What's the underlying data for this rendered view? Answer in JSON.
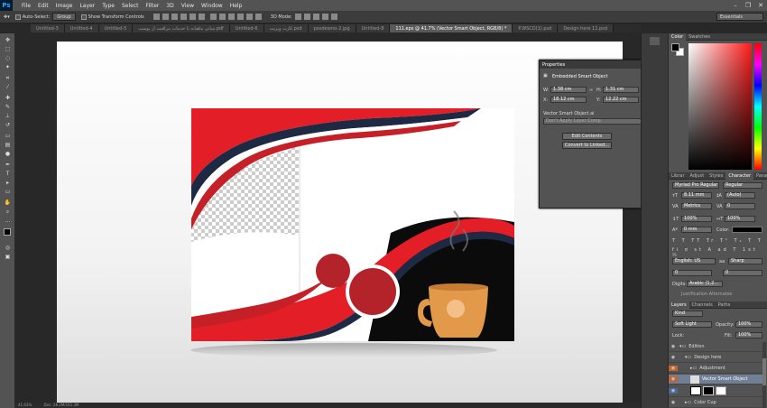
{
  "app": {
    "logo": "Ps"
  },
  "menu": [
    "File",
    "Edit",
    "Image",
    "Layer",
    "Type",
    "Select",
    "Filter",
    "3D",
    "View",
    "Window",
    "Help"
  ],
  "window_controls": [
    "–",
    "❐",
    "✕"
  ],
  "options": {
    "auto_select_label": "Auto-Select:",
    "auto_select_value": "Group",
    "transform_label": "Show Transform Controls",
    "mode_label": "3D Mode:",
    "workspace": "Essentials"
  },
  "tabs": [
    {
      "label": "Untitled-3"
    },
    {
      "label": "Untitled-4"
    },
    {
      "label": "Untitled-5"
    },
    {
      "label": "سانی ماهیانه با خدمات مراقبت از پوست.pdf"
    },
    {
      "label": "Untitled-6"
    },
    {
      "label": "کارت ویزیت.psd"
    },
    {
      "label": "posdesmo-2.jpg"
    },
    {
      "label": "Untitled-8"
    },
    {
      "label": "111.eps @ 41.7% (Vector Smart Object, RGB/8) *",
      "active": true
    },
    {
      "label": "P.WSCD(1).psd"
    },
    {
      "label": "Design here 11.psd"
    }
  ],
  "properties": {
    "tab_label": "Properties",
    "type_label": "Embedded Smart Object",
    "w_label": "W:",
    "w_value": "1.38 cm",
    "h_label": "H:",
    "h_value": "1.31 cm",
    "x_label": "X:",
    "x_value": "18.12 cm",
    "y_label": "Y:",
    "y_value": "12.22 cm",
    "source_label": "Vector Smart Object.ai",
    "layer_comp": "Don't Apply Layer Comp",
    "edit_button": "Edit Contents",
    "convert_button": "Convert to Linked..."
  },
  "color_panel": {
    "tabs": [
      "Color",
      "Swatches"
    ]
  },
  "char_panel": {
    "tabs": [
      "Librar",
      "Adjust",
      "Styles",
      "Character",
      "Parag"
    ],
    "font_family": "Myriad Pro Regular",
    "font_style": "Regular",
    "font_size": "8.11 mm",
    "leading": "(Auto)",
    "kerning": "Metrics",
    "tracking": "0",
    "v_scale": "100%",
    "h_scale": "100%",
    "baseline": "0 mm",
    "color_label": "Color:",
    "language": "English: US",
    "antialias": "Sharp",
    "aa_label": "aa",
    "digits_label": "Digits:",
    "digits_value": "Arabic (1,2...",
    "justification": "Justification Alternates"
  },
  "layers_panel": {
    "tabs": [
      "Layers",
      "Channels",
      "Paths"
    ],
    "filter": "Kind",
    "blend": "Soft Light",
    "opacity_label": "Opacity:",
    "opacity": "100%",
    "fill_label": "Fill:",
    "fill": "100%",
    "lock_label": "Lock:",
    "layers": [
      {
        "name": "Edition",
        "type": "group",
        "indent": 0
      },
      {
        "name": "Design here",
        "type": "group",
        "indent": 1
      },
      {
        "name": "Adjustment",
        "type": "group",
        "indent": 2
      },
      {
        "name": "Vector Smart Object",
        "type": "smart",
        "indent": 2,
        "selected": true
      },
      {
        "name": "",
        "type": "mask",
        "indent": 2
      },
      {
        "name": "Color Cup",
        "type": "group",
        "indent": 1
      }
    ]
  },
  "status": {
    "zoom": "41.63%",
    "doc": "Doc: 28.2M/161.3M"
  },
  "colors": {
    "red": "#e31e26",
    "navy": "#1e2a44",
    "dark_red": "#b5232a",
    "cup": "#e29a4a"
  }
}
